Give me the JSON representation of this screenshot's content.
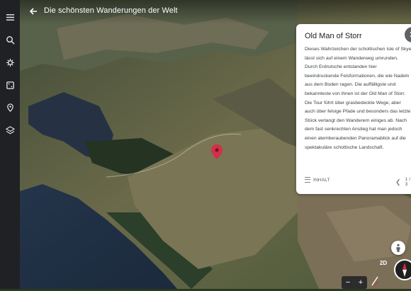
{
  "header": {
    "title": "Die schönsten Wanderungen der Welt"
  },
  "sidebar": {
    "items": [
      {
        "icon": "menu-icon"
      },
      {
        "icon": "search-icon"
      },
      {
        "icon": "voyager-icon"
      },
      {
        "icon": "random-dice-icon"
      },
      {
        "icon": "projects-pin-icon"
      },
      {
        "icon": "layers-icon"
      }
    ]
  },
  "card": {
    "title": "Old Man of Storr",
    "lines": [
      "Dieses Wahrzeichen der schottischen Isle of Skye",
      "lässt sich auf einem Wanderweg umrunden.",
      "Durch Erdrutsche entstanden hier",
      "beeindruckende Felsformationen, die wie Nadeln",
      "aus dem Boden ragen. Die auffälligste und",
      "bekannteste von ihnen ist der Old Man of Storr.",
      "Die Tour führt über grasbedeckte Wege, aber",
      "auch über felsige Pfade und besonders das letzte",
      "Stück verlangt den Wanderern einiges ab. Nach",
      "dem fast senkrechten Anstieg hat man jedoch",
      "einen atemberaubenden Panoramablick auf die",
      "spektakuläre schottische Landschaft."
    ],
    "contents_label": "INHALT",
    "pager": "1 / 3"
  },
  "controls": {
    "view_toggle": "2D",
    "zoom_out": "−",
    "zoom_in": "+"
  },
  "colors": {
    "accent_pin": "#d32f4a",
    "rail_bg": "#202124"
  }
}
